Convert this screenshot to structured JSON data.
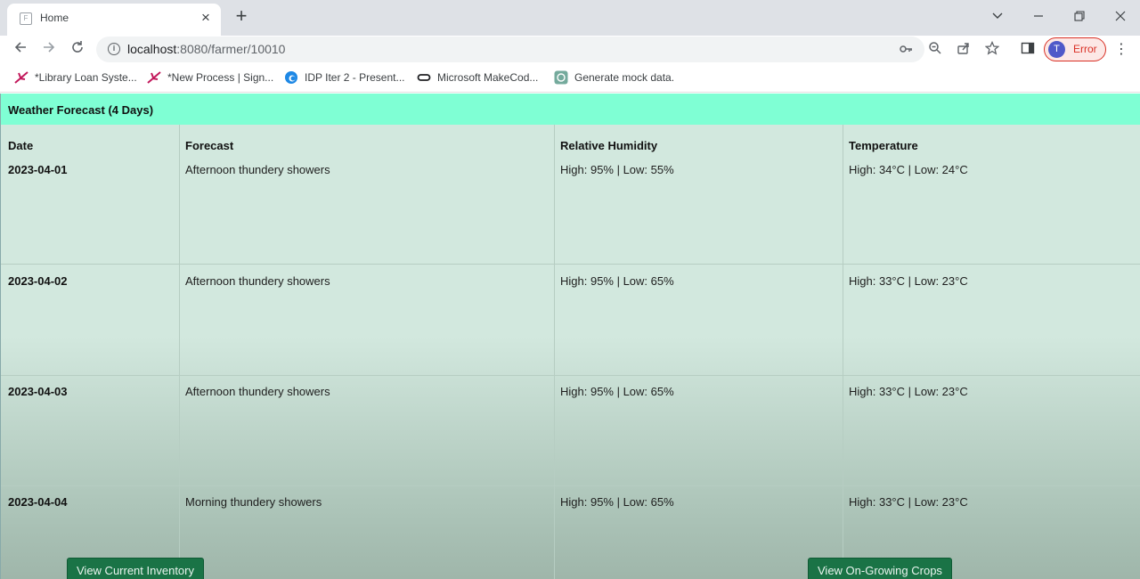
{
  "browser": {
    "tab_title": "Home",
    "favicon_letter": "F",
    "url_host": "localhost",
    "url_path": ":8080/farmer/10010",
    "profile_initial": "T",
    "profile_label": "Error"
  },
  "bookmarks": [
    {
      "label": "*Library Loan Syste...",
      "icon": "pen-icon"
    },
    {
      "label": "*New Process | Sign...",
      "icon": "pen-icon"
    },
    {
      "label": "IDP Iter 2 - Present...",
      "icon": "edge-icon"
    },
    {
      "label": "Microsoft MakeCod...",
      "icon": "link-icon"
    },
    {
      "label": "Generate mock data.",
      "icon": "openai-icon"
    }
  ],
  "forecast": {
    "title": "Weather Forecast (4 Days)",
    "headers": {
      "date": "Date",
      "forecast": "Forecast",
      "humidity": "Relative Humidity",
      "temperature": "Temperature"
    },
    "rows": [
      {
        "date": "2023-04-01",
        "forecast": "Afternoon thundery showers",
        "humidity": "High: 95% | Low: 55%",
        "temperature": "High: 34°C | Low: 24°C"
      },
      {
        "date": "2023-04-02",
        "forecast": "Afternoon thundery showers",
        "humidity": "High: 95% | Low: 65%",
        "temperature": "High: 33°C | Low: 23°C"
      },
      {
        "date": "2023-04-03",
        "forecast": "Afternoon thundery showers",
        "humidity": "High: 95% | Low: 65%",
        "temperature": "High: 33°C | Low: 23°C"
      },
      {
        "date": "2023-04-04",
        "forecast": "Morning thundery showers",
        "humidity": "High: 95% | Low: 65%",
        "temperature": "High: 33°C | Low: 23°C"
      }
    ]
  },
  "actions": {
    "inventory_label": "View Current Inventory",
    "crops_label": "View On-Growing Crops"
  },
  "colors": {
    "header_band": "#7fffd4",
    "table_bg": "#d2e8de",
    "button_green": "#1a7346"
  }
}
